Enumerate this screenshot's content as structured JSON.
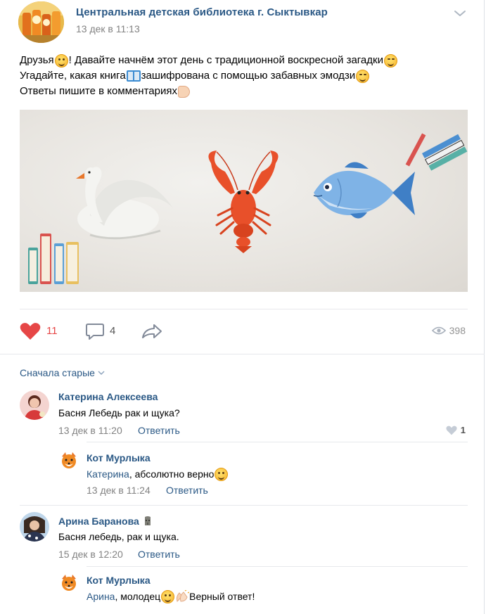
{
  "post": {
    "group_name": "Центральная детская библиотека г. Сыктывкар",
    "date": "13 дек в 11:13",
    "text_lines": [
      {
        "before": "Друзья",
        "after": "! Давайте начнём этот день с традиционной воскресной загадки"
      },
      {
        "before": "Угадайте, какая книга",
        "after": " зашифрована с помощью забавных эмодзи"
      },
      {
        "before": "Ответы пишите в комментариях",
        "after": ""
      }
    ],
    "image_emojis": [
      "swan",
      "lobster",
      "fish",
      "books",
      "pencils"
    ]
  },
  "actions": {
    "likes": "11",
    "comments": "4",
    "views": "398",
    "like_color": "#e64646"
  },
  "comments_sort": "Сначала старые",
  "comments": [
    {
      "author": "Катерина Алексеева",
      "text": "Басня Лебедь рак и щука?",
      "date": "13 дек в 11:20",
      "reply_label": "Ответить",
      "likes": "1",
      "replies": [
        {
          "author": "Кот Мурлыка",
          "mention": "Катерина",
          "text": ", абсолютно верно",
          "date": "13 дек в 11:24",
          "reply_label": "Ответить"
        }
      ]
    },
    {
      "author": "Арина Баранова",
      "text": "Басня лебедь, рак и щука.",
      "date": "15 дек в 12:20",
      "reply_label": "Ответить",
      "replies": [
        {
          "author": "Кот Мурлыка",
          "mention": "Арина",
          "text": ", молодец",
          "text_after": " Верный ответ!"
        }
      ]
    }
  ],
  "colors": {
    "link": "#2a5885",
    "meta": "#828282",
    "divider": "#e7e8ec"
  }
}
